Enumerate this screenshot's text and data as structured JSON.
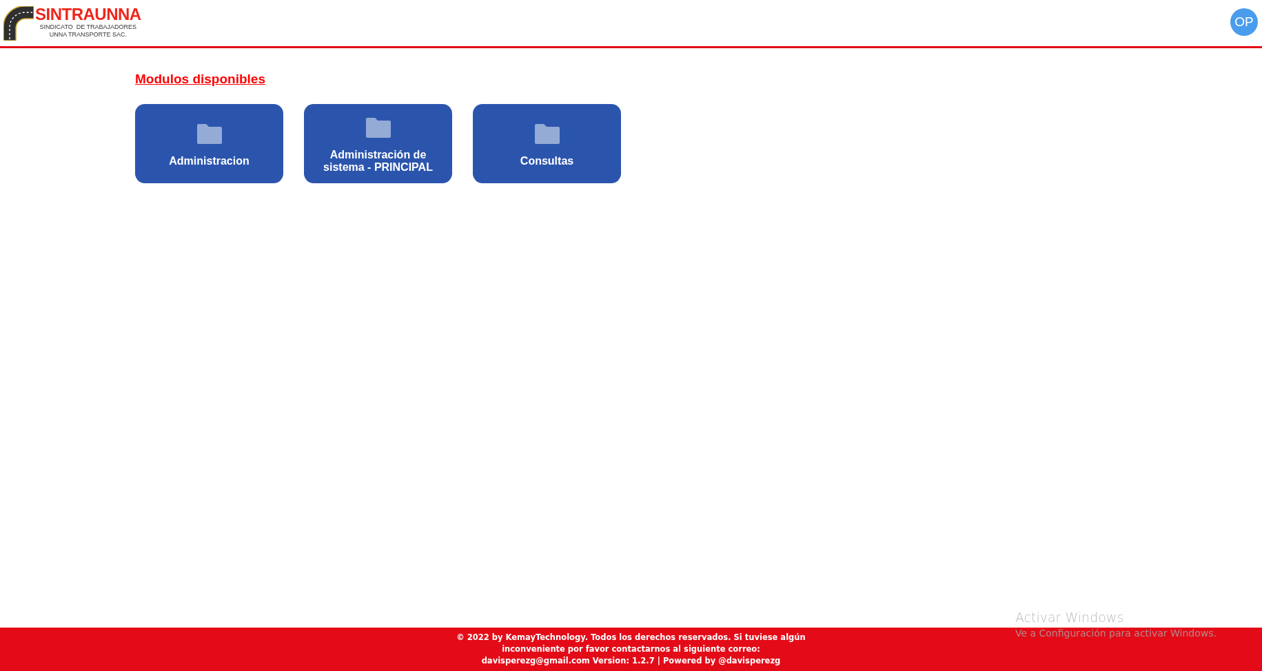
{
  "header": {
    "logo": {
      "name": "SINTRAUNNA",
      "subtitle_lines": [
        "SINDICATO  DE TRABAJADORES",
        "UNNA TRANSPORTE SAC."
      ]
    },
    "avatar": {
      "initials": "OP"
    }
  },
  "modules_title": "Modulos disponibles",
  "modules": [
    {
      "label": "Administracion"
    },
    {
      "label": "Administración de sistema - PRINCIPAL"
    },
    {
      "label": "Consultas"
    }
  ],
  "footer": {
    "lines": [
      "© 2022 by KemayTechnology. Todos los derechos reservados. Si tuviese algún",
      "inconveniente por favor contactarnos al siguiente correo:",
      "davisperezg@gmail.com Version: 1.2.7 | Powered by @davisperezg"
    ]
  },
  "os_overlay": {
    "title": "Activar Windows",
    "message": "Ve a Configuración para activar Windows."
  }
}
